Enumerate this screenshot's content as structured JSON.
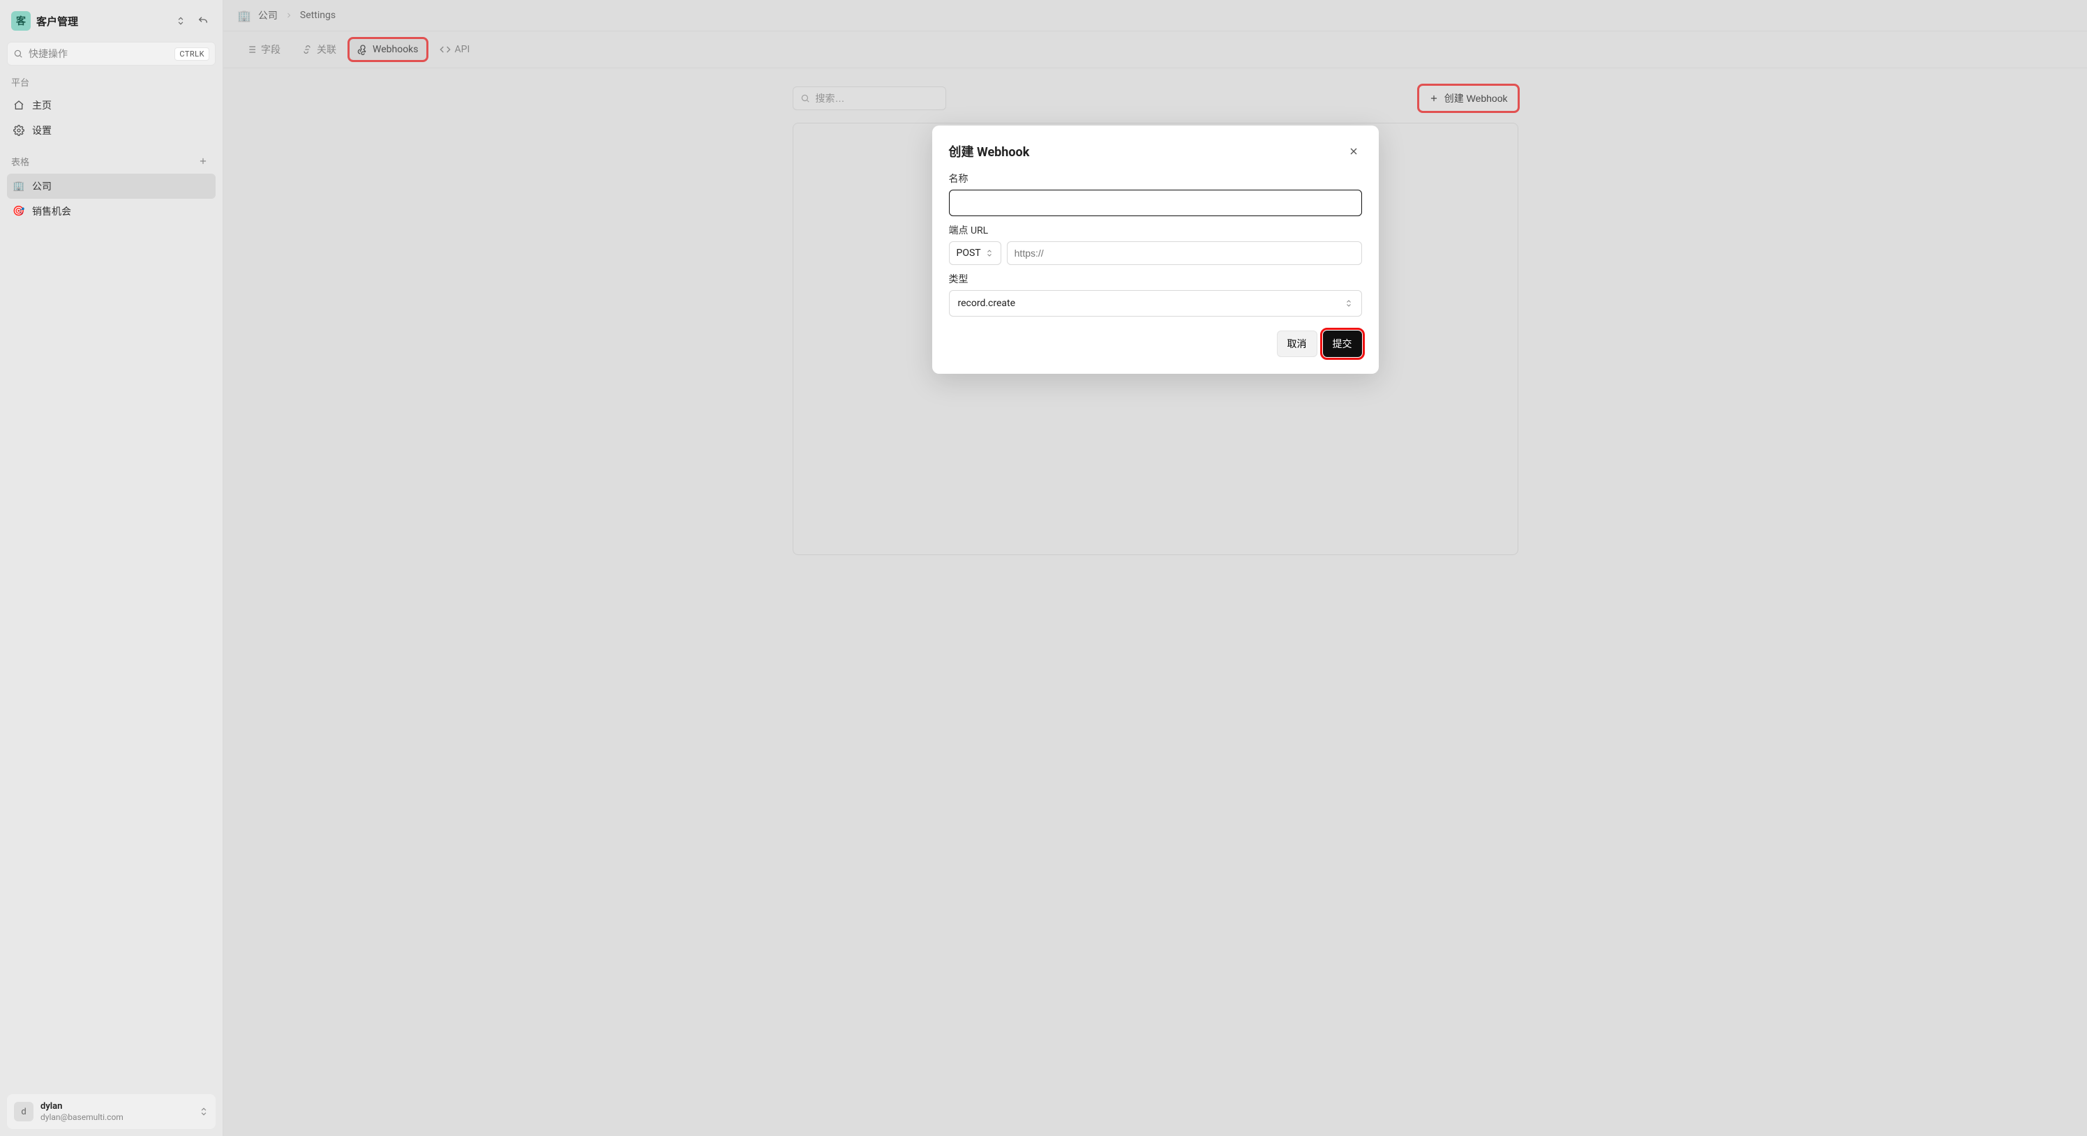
{
  "workspace": {
    "avatar_letter": "客",
    "title": "客户管理"
  },
  "quicksearch": {
    "placeholder": "快捷操作",
    "shortcut": "CTRLK"
  },
  "sidebar": {
    "section_platform": "平台",
    "nav": [
      {
        "label": "主页"
      },
      {
        "label": "设置"
      }
    ],
    "section_tables": "表格",
    "tables": [
      {
        "icon": "🏢",
        "label": "公司",
        "active": true
      },
      {
        "icon": "🎯",
        "label": "销售机会",
        "active": false
      }
    ]
  },
  "user": {
    "avatar_letter": "d",
    "name": "dylan",
    "email": "dylan@basemulti.com"
  },
  "breadcrumb": {
    "icon": "🏢",
    "items": [
      "公司",
      "Settings"
    ]
  },
  "tabs": [
    {
      "label": "字段"
    },
    {
      "label": "关联"
    },
    {
      "label": "Webhooks",
      "active": true,
      "highlighted": true
    },
    {
      "label": "API"
    }
  ],
  "toolbar": {
    "search_placeholder": "搜索…",
    "create_button": "创建 Webhook"
  },
  "modal": {
    "title": "创建 Webhook",
    "field_name_label": "名称",
    "field_name_value": "",
    "field_endpoint_label": "端点 URL",
    "method_value": "POST",
    "url_placeholder": "https://",
    "field_type_label": "类型",
    "type_value": "record.create",
    "cancel": "取消",
    "submit": "提交"
  }
}
